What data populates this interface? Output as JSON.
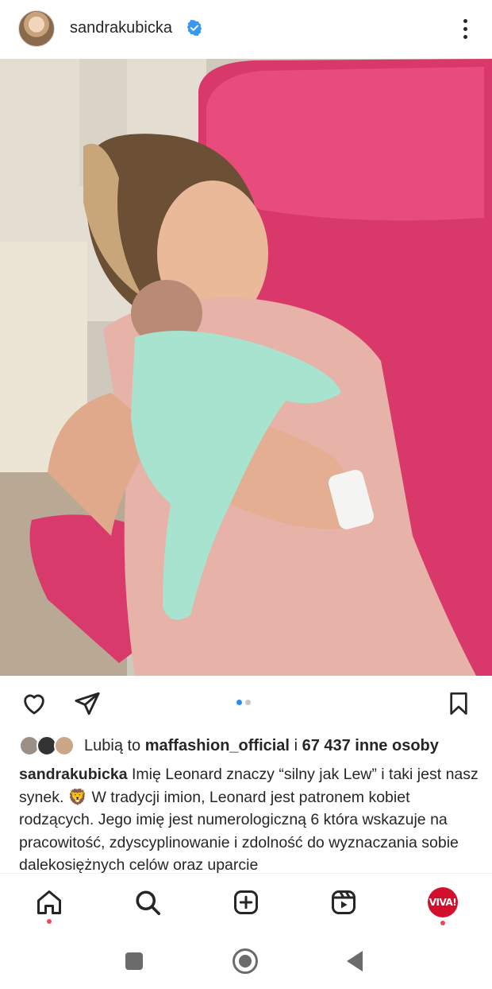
{
  "post": {
    "username": "sandrakubicka",
    "verified": true,
    "photo_description_icon": "photo"
  },
  "actions": {
    "like_icon": "heart-icon",
    "share_icon": "paper-plane-icon",
    "save_icon": "bookmark-icon",
    "carousel_pages": 2,
    "carousel_current": 1
  },
  "likes": {
    "prefix": "Lubią to",
    "user": "maffashion_official",
    "middle": "i",
    "count_text": "67 437 inne osoby"
  },
  "caption": {
    "username": "sandrakubicka",
    "text": "Imię Leonard znaczy “silny jak Lew” i taki jest nasz synek. 🦁 W tradycji imion, Leonard jest patronem kobiet rodzących. Jego imię jest numerologiczną 6 która wskazuje na pracowitość, zdyscyplinowanie i zdolność do wyznaczania sobie dalekosiężnych celów oraz uparcie"
  },
  "nav": {
    "profile_badge": "VIVA!",
    "items": [
      "home-icon",
      "search-icon",
      "create-icon",
      "reels-icon",
      "profile-avatar"
    ]
  },
  "colors": {
    "accent_blue": "#2d8cf0",
    "notification_red": "#ed4956",
    "verified_blue": "#3897f0"
  }
}
